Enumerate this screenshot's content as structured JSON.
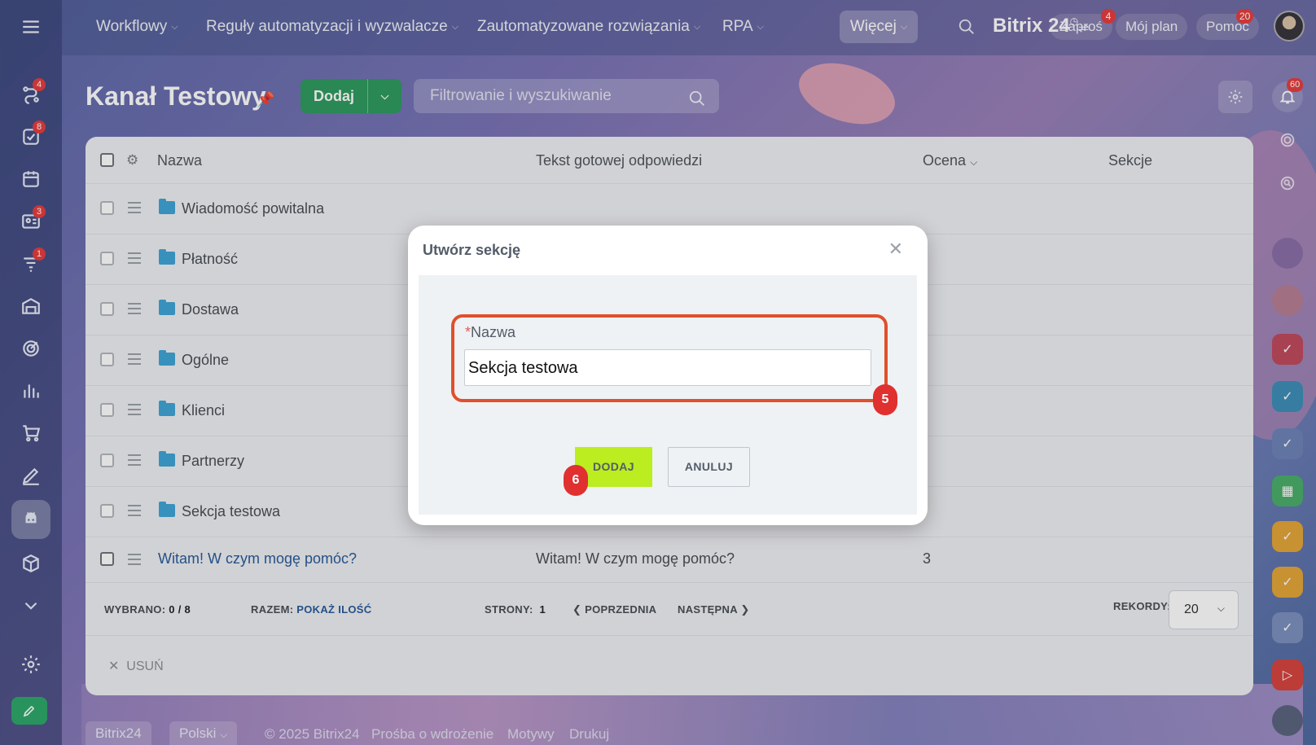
{
  "topbar": {
    "menu": [
      {
        "label": "Workflowy"
      },
      {
        "label": "Reguły automatyzacji i wyzwalacze"
      },
      {
        "label": "Zautomatyzowane rozwiązania"
      },
      {
        "label": "RPA"
      }
    ],
    "more_label": "Więcej",
    "brand": "Bitrix 24",
    "invite_label": "Zaproś",
    "invite_badge": "4",
    "plan_label": "Mój plan",
    "help_label": "Pomoc",
    "help_badge": "20"
  },
  "sidebar": {
    "badges": {
      "sb1": "4",
      "sb2": "8",
      "sb4": "3",
      "sb5": "1"
    }
  },
  "rail": {
    "notifications_badge": "60"
  },
  "page": {
    "title": "Kanał Testowy",
    "add_label": "Dodaj",
    "filter_placeholder": "Filtrowanie i wyszukiwanie"
  },
  "grid": {
    "columns": [
      "Nazwa",
      "Tekst gotowej odpowiedzi",
      "Ocena",
      "Sekcje"
    ],
    "folders": [
      "Wiadomość powitalna",
      "Płatność",
      "Dostawa",
      "Ogólne",
      "Klienci",
      "Partnerzy",
      "Sekcja testowa"
    ],
    "item": {
      "name": "Witam! W czym mogę pomóc?",
      "text": "Witam! W czym mogę pomóc?",
      "score": "3"
    },
    "footer": {
      "selected_label": "WYBRANO:",
      "selected_value": "0 / 8",
      "total_label": "RAZEM:",
      "total_link": "POKAŻ ILOŚĆ",
      "pages_label": "STRONY:",
      "pages_value": "1",
      "prev": "POPRZEDNIA",
      "next": "NASTĘPNA",
      "records_label": "REKORDY:",
      "records_value": "20"
    },
    "delete_label": "USUŃ"
  },
  "dialog": {
    "title": "Utwórz sekcję",
    "field_label": "Nazwa",
    "field_value": "Sekcja testowa",
    "add": "DODAJ",
    "cancel": "ANULUJ",
    "step_field": "5",
    "step_add": "6"
  },
  "bottombar": {
    "brand": "Bitrix24",
    "language": "Polski",
    "copyright": "© 2025 Bitrix24",
    "link1": "Prośba o wdrożenie",
    "link2": "Motywy",
    "link3": "Drukuj"
  },
  "colors": {
    "accent_green": "#2f9b5f",
    "dialog_add_bg": "#bbed21",
    "highlight": "#e0502c",
    "badge_red": "#e63e3e",
    "folder_blue": "#40a6d6"
  }
}
